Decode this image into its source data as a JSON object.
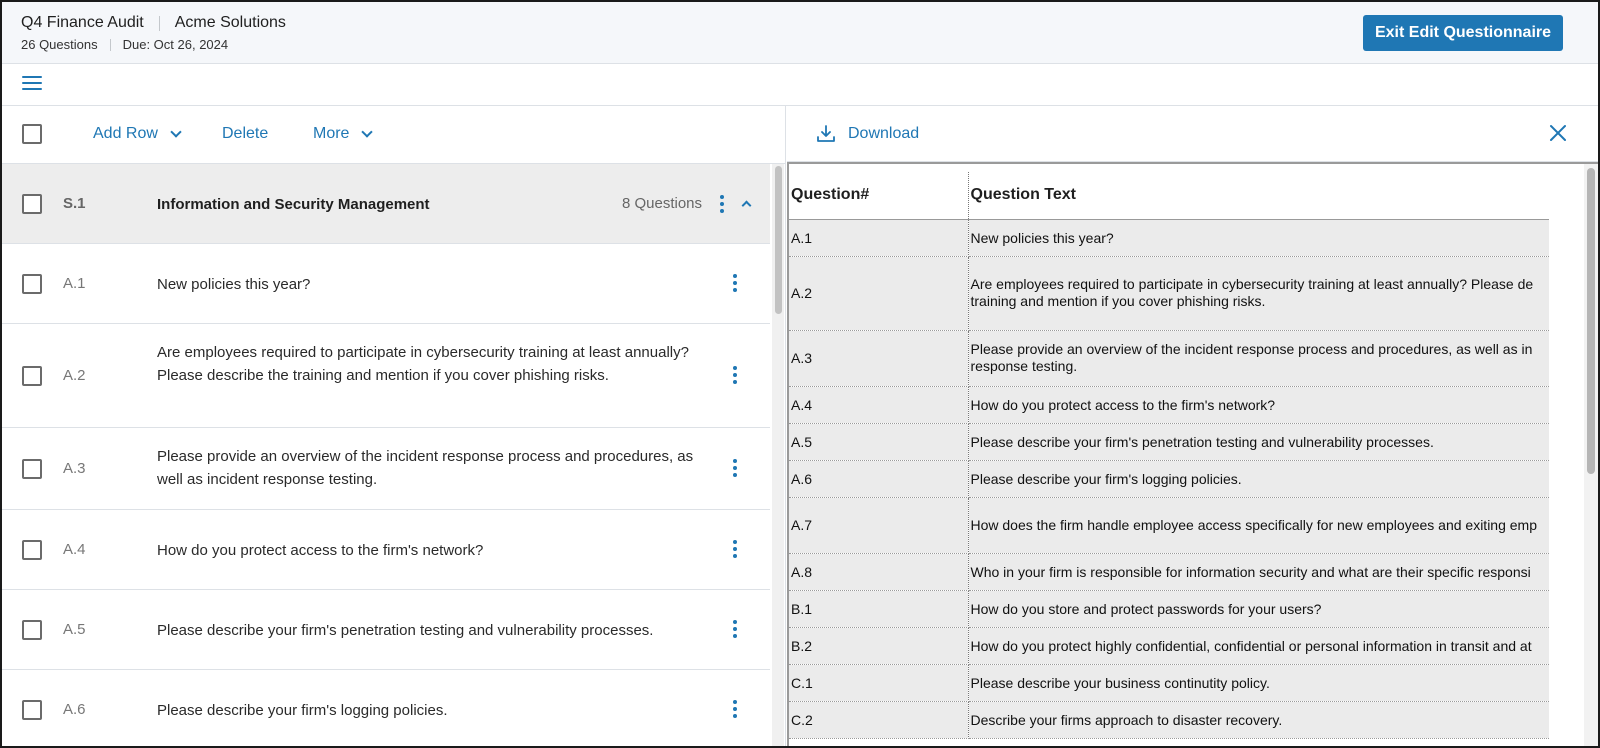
{
  "header": {
    "audit_name": "Q4 Finance Audit",
    "company": "Acme Solutions",
    "question_count": "26 Questions",
    "due": "Due: Oct 26, 2024",
    "exit_button": "Exit Edit Questionnaire"
  },
  "toolbar": {
    "add_row": "Add Row",
    "delete": "Delete",
    "more": "More"
  },
  "section": {
    "number": "S.1",
    "title": "Information and Security Management",
    "count": "8 Questions"
  },
  "questions": [
    {
      "num": "A.1",
      "text": "New policies this year?"
    },
    {
      "num": "A.2",
      "text": "Are employees required to participate in cybersecurity training at least annually? Please describe the training and mention if you cover phishing risks."
    },
    {
      "num": "A.3",
      "text": "Please provide an overview of the incident response process and procedures, as well as incident response testing."
    },
    {
      "num": "A.4",
      "text": "How do you protect access to the firm's network?"
    },
    {
      "num": "A.5",
      "text": "Please describe your firm's penetration testing and vulnerability processes."
    },
    {
      "num": "A.6",
      "text": "Please describe your firm's logging policies."
    }
  ],
  "preview": {
    "download": "Download",
    "col_num": "Question#",
    "col_text": "Question Text",
    "rows": [
      {
        "num": "A.1",
        "text": "New policies this year?"
      },
      {
        "num": "A.2",
        "text": "Are employees required to participate in cybersecurity training at least annually? Please de training and mention if you cover phishing risks."
      },
      {
        "num": "A.3",
        "text": "Please provide an overview of the incident response process and procedures, as well as in response testing."
      },
      {
        "num": "A.4",
        "text": "How do you protect access to the firm's network?"
      },
      {
        "num": "A.5",
        "text": "Please describe your firm's penetration testing and vulnerability processes."
      },
      {
        "num": "A.6",
        "text": "Please describe your firm's logging policies."
      },
      {
        "num": "A.7",
        "text": "How does the firm handle employee access specifically for new employees and exiting emp"
      },
      {
        "num": "A.8",
        "text": "Who in your firm is responsible for information security and what are their specific responsi"
      },
      {
        "num": "B.1",
        "text": "How do you store and protect passwords for your users?"
      },
      {
        "num": "B.2",
        "text": "How do you protect highly confidential, confidential or personal information in transit and at"
      },
      {
        "num": "C.1",
        "text": "Please describe your business continutity policy."
      },
      {
        "num": "C.2",
        "text": "Describe your firms approach to disaster recovery."
      }
    ]
  },
  "colors": {
    "accent": "#1f77b4",
    "section_bg": "#ededed",
    "sheet_cell_bg": "#ebebeb"
  }
}
